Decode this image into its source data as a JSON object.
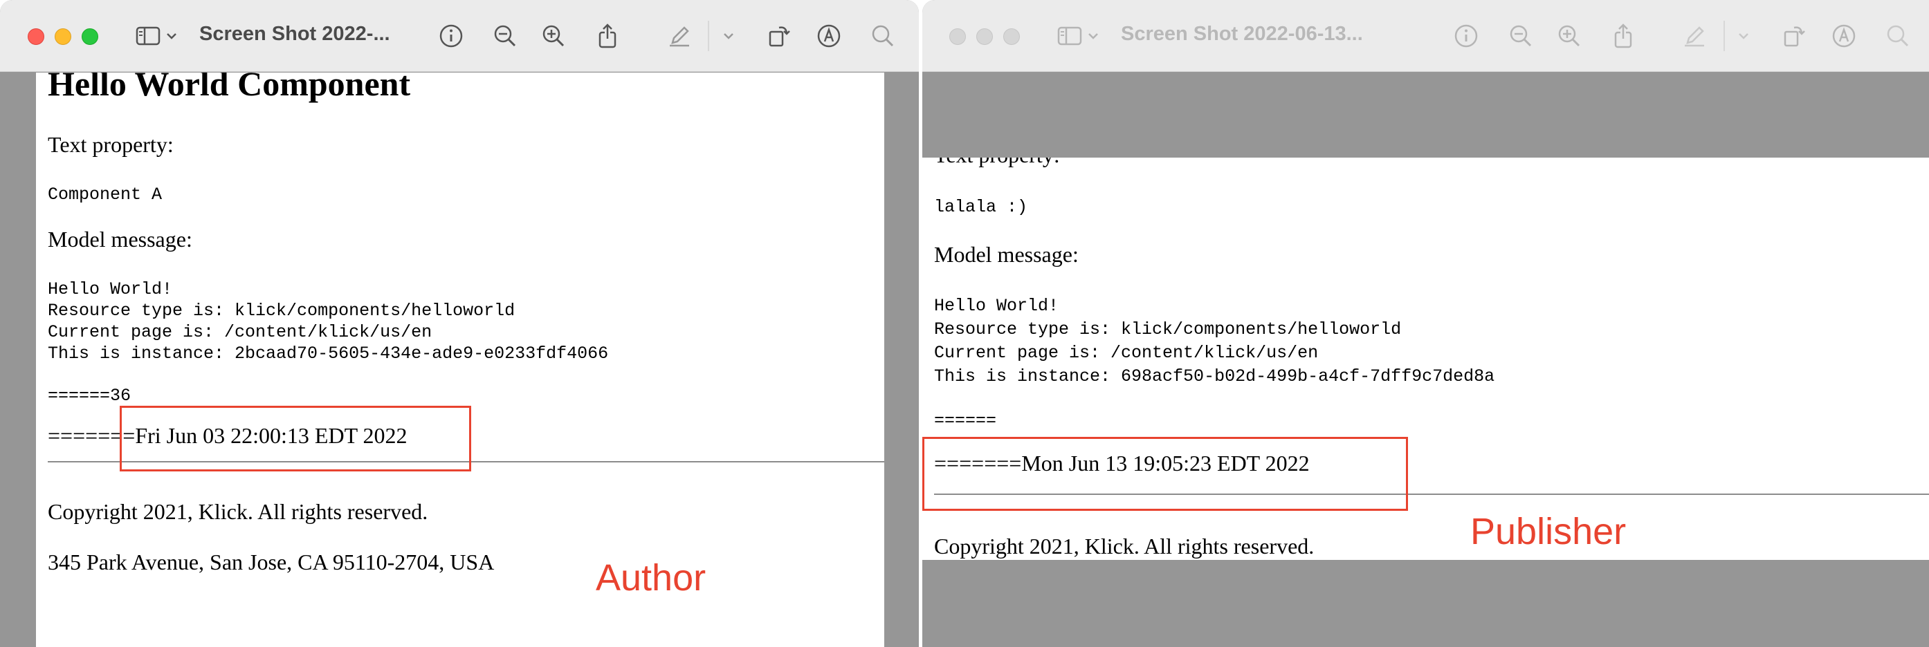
{
  "colors": {
    "annotation_red": "#e8432f",
    "window_background": "#969696",
    "titlebar": "#ebebeb"
  },
  "left_window": {
    "title": "Screen Shot 2022-...",
    "toolbar_icons": [
      "sidebar-icon",
      "chevron-down-icon",
      "info-icon",
      "zoom-out-icon",
      "zoom-in-icon",
      "share-icon",
      "markup-pen-icon",
      "chevron-down-icon",
      "rotate-icon",
      "markup-icon",
      "search-icon"
    ],
    "page": {
      "heading": "Hello World Component",
      "text_property_label": "Text property:",
      "text_property_value": "Component A",
      "model_message_label": "Model message:",
      "model_lines": [
        "Hello World!",
        "Resource type is: klick/components/helloworld",
        "Current page is:  /content/klick/us/en",
        "This is instance: 2bcaad70-5605-434e-ade9-e0233fdf4066"
      ],
      "separator_line": "======36",
      "timestamp_line": "=======Fri Jun 03 22:00:13 EDT 2022",
      "copyright": "Copyright 2021, Klick. All rights reserved.",
      "address": "345 Park Avenue, San Jose, CA 95110-2704, USA"
    },
    "annotation": "Author"
  },
  "right_window": {
    "title": "Screen Shot 2022-06-13...",
    "toolbar_icons": [
      "sidebar-icon",
      "chevron-down-icon",
      "info-icon",
      "zoom-out-icon",
      "zoom-in-icon",
      "share-icon",
      "markup-pen-icon",
      "chevron-down-icon",
      "rotate-icon",
      "markup-icon",
      "search-icon"
    ],
    "page": {
      "text_property_label": "Text property:",
      "text_property_value": "lalala :)",
      "model_message_label": "Model message:",
      "model_lines": [
        "Hello World!",
        "Resource type is: klick/components/helloworld",
        "Current page is:  /content/klick/us/en",
        "This is instance: 698acf50-b02d-499b-a4cf-7dff9c7ded8a"
      ],
      "separator_line": "======",
      "timestamp_line": "=======Mon Jun 13 19:05:23 EDT 2022",
      "copyright": "Copyright 2021, Klick. All rights reserved."
    },
    "annotation": "Publisher"
  }
}
